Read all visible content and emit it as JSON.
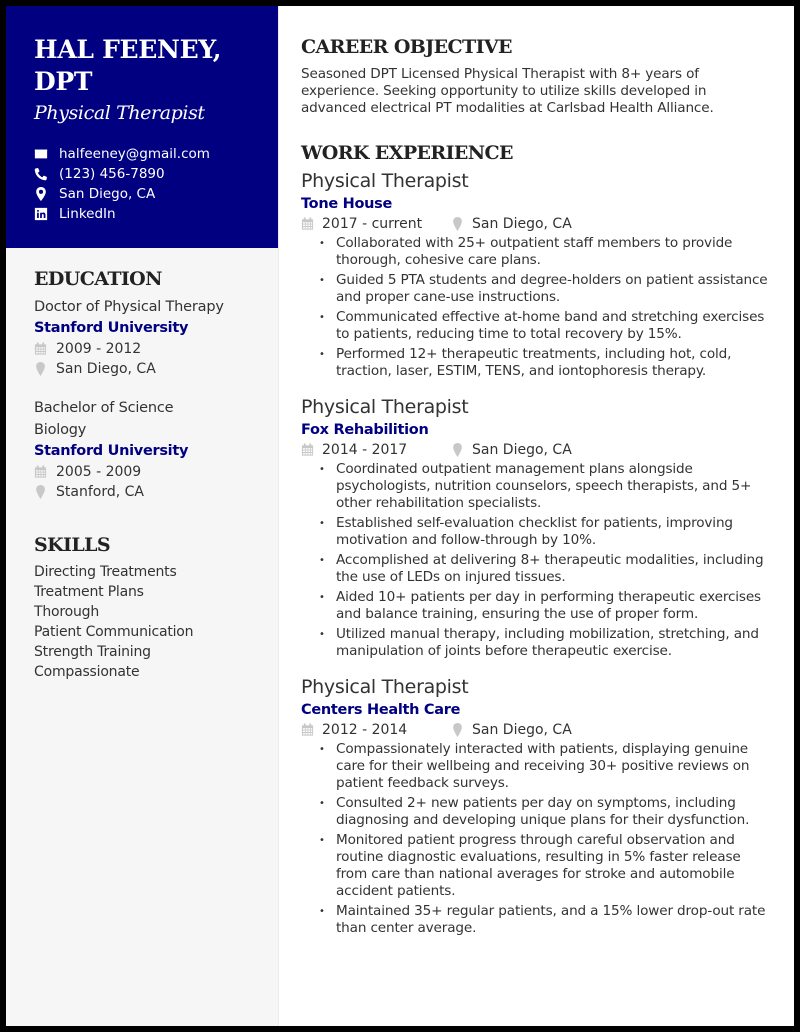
{
  "header": {
    "name": "HAL FEENEY, DPT",
    "title": "Physical Therapist",
    "contacts": [
      {
        "icon": "envelope-icon",
        "text": "halfeeney@gmail.com"
      },
      {
        "icon": "phone-icon",
        "text": "(123) 456-7890"
      },
      {
        "icon": "map-pin-icon",
        "text": "San Diego, CA"
      },
      {
        "icon": "linkedin-icon",
        "text": "LinkedIn"
      }
    ]
  },
  "colors": {
    "accent": "#000080",
    "sidebar_bg": "#f6f6f6",
    "icon_gray": "#c8c8c8",
    "text": "#333333"
  },
  "education": {
    "heading": "EDUCATION",
    "items": [
      {
        "degree": "Doctor of Physical Therapy",
        "school": "Stanford University",
        "dates": "2009 - 2012",
        "location": "San Diego, CA"
      },
      {
        "degree": "Bachelor of Science Biology",
        "school": "Stanford University",
        "dates": "2005 - 2009",
        "location": "Stanford, CA"
      }
    ]
  },
  "skills": {
    "heading": "SKILLS",
    "items": [
      "Directing Treatments",
      "Treatment Plans",
      "Thorough",
      "Patient Communication",
      "Strength Training",
      "Compassionate"
    ]
  },
  "objective": {
    "heading": "CAREER OBJECTIVE",
    "text": "Seasoned DPT Licensed Physical Therapist with 8+ years of experience. Seeking opportunity to utilize skills developed in advanced electrical PT modalities at Carlsbad Health Alliance."
  },
  "work": {
    "heading": "WORK EXPERIENCE",
    "jobs": [
      {
        "title": "Physical Therapist",
        "company": "Tone House",
        "dates": "2017 - current",
        "location": "San Diego, CA",
        "bullets": [
          "Collaborated with 25+ outpatient staff members to provide thorough, cohesive care plans.",
          "Guided 5 PTA students and degree-holders on patient assistance and proper cane-use instructions.",
          "Communicated effective at-home band and stretching exercises to patients, reducing time to total recovery by 15%.",
          "Performed 12+ therapeutic treatments, including hot, cold, traction, laser, ESTIM, TENS, and iontophoresis therapy."
        ]
      },
      {
        "title": "Physical Therapist",
        "company": "Fox Rehabilition",
        "dates": "2014 - 2017",
        "location": "San Diego, CA",
        "bullets": [
          "Coordinated outpatient management plans alongside psychologists, nutrition counselors, speech therapists, and 5+ other rehabilitation specialists.",
          "Established self-evaluation checklist for patients, improving motivation and follow-through by 10%.",
          "Accomplished at delivering 8+ therapeutic modalities, including the use of LEDs on injured tissues.",
          "Aided 10+ patients per day in performing therapeutic exercises and balance training, ensuring the use of proper form.",
          "Utilized manual therapy, including mobilization, stretching, and manipulation of joints before therapeutic exercise."
        ]
      },
      {
        "title": "Physical Therapist",
        "company": "Centers Health Care",
        "dates": "2012 - 2014",
        "location": "San Diego, CA",
        "bullets": [
          "Compassionately interacted with patients, displaying genuine care for their wellbeing and receiving 30+ positive reviews on patient feedback surveys.",
          "Consulted 2+ new patients per day on symptoms, including diagnosing and developing unique plans for their dysfunction.",
          "Monitored patient progress through careful observation and routine diagnostic evaluations, resulting in 5% faster release from care than national averages for stroke and automobile accident patients.",
          "Maintained 35+ regular patients, and a 15% lower drop-out rate than center average."
        ]
      }
    ]
  }
}
